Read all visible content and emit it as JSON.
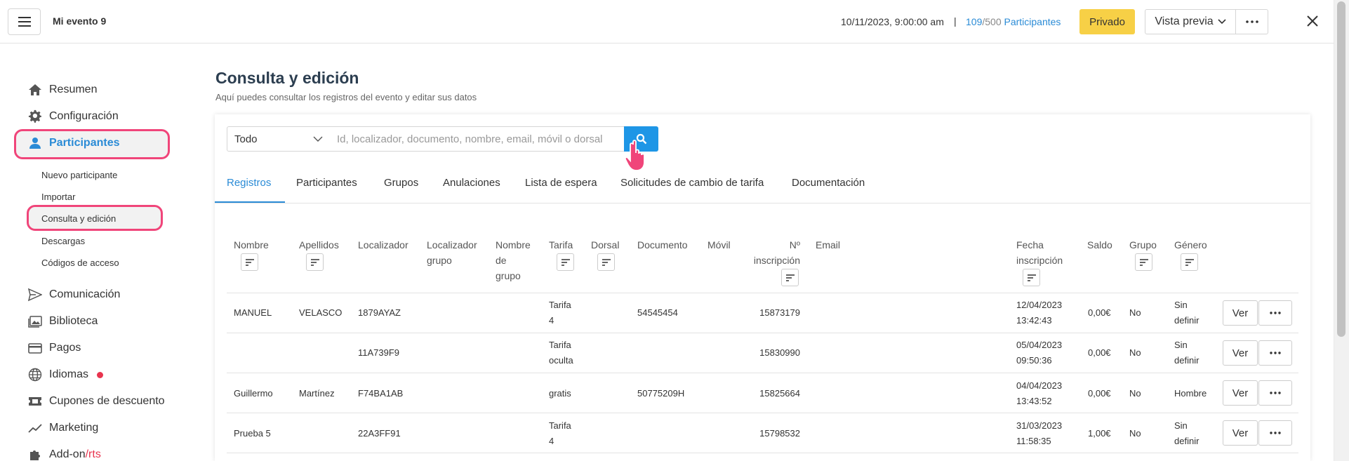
{
  "header": {
    "event_name": "Mi evento 9",
    "date": "10/11/2023, 9:00:00 am",
    "separator": "|",
    "count_current": "109",
    "count_total": "/500",
    "count_label": " Participantes",
    "privado_label": "Privado",
    "vista_label": "Vista previa"
  },
  "sidebar": {
    "items": [
      {
        "label": "Resumen",
        "icon": "home-icon"
      },
      {
        "label": "Configuración",
        "icon": "gear-icon"
      },
      {
        "label": "Participantes",
        "icon": "person-icon"
      },
      {
        "label": "Comunicación",
        "icon": "send-icon"
      },
      {
        "label": "Biblioteca",
        "icon": "images-icon"
      },
      {
        "label": "Pagos",
        "icon": "card-icon"
      },
      {
        "label": "Idiomas",
        "icon": "globe-icon"
      },
      {
        "label": "Cupones de descuento",
        "icon": "ticket-icon"
      },
      {
        "label": "Marketing",
        "icon": "trend-icon"
      },
      {
        "label": "Add-on",
        "icon": "puzzle-icon"
      }
    ],
    "addon_suffix": "/rts",
    "subitems": [
      "Nuevo participante",
      "Importar",
      "Consulta y edición",
      "Descargas",
      "Códigos de acceso"
    ]
  },
  "main": {
    "title": "Consulta y edición",
    "subtitle": "Aquí puedes consultar los registros del evento y editar sus datos",
    "filter_value": "Todo",
    "search_placeholder": "Id, localizador, documento, nombre, email, móvil o dorsal",
    "tabs": [
      "Registros",
      "Participantes",
      "Grupos",
      "Anulaciones",
      "Lista de espera",
      "Solicitudes de cambio de tarifa",
      "Documentación"
    ]
  },
  "table": {
    "headers": {
      "nombre": "Nombre",
      "apellidos": "Apellidos",
      "localizador": "Localizador",
      "localizador_grupo_1": "Localizador",
      "localizador_grupo_2": "grupo",
      "nombre_grupo_1": "Nombre",
      "nombre_grupo_2": "de",
      "nombre_grupo_3": "grupo",
      "tarifa": "Tarifa",
      "dorsal": "Dorsal",
      "documento": "Documento",
      "movil": "Móvil",
      "num_insc_1": "Nº",
      "num_insc_2": "inscripción",
      "email": "Email",
      "fecha_1": "Fecha",
      "fecha_2": "inscripción",
      "saldo": "Saldo",
      "grupo": "Grupo",
      "genero": "Género"
    },
    "ver_label": "Ver",
    "rows": [
      {
        "nombre": "MANUEL",
        "apellidos": "VELASCO",
        "localizador": "1879AYAZ",
        "tarifa_1": "Tarifa",
        "tarifa_2": "4",
        "documento": "54545454",
        "num": "15873179",
        "fecha_1": "12/04/2023",
        "fecha_2": "13:42:43",
        "saldo": "0,00€",
        "grupo": "No",
        "genero_1": "Sin",
        "genero_2": "definir"
      },
      {
        "nombre": "",
        "apellidos": "",
        "localizador": "11A739F9",
        "tarifa_1": "Tarifa",
        "tarifa_2": "oculta",
        "documento": "",
        "num": "15830990",
        "fecha_1": "05/04/2023",
        "fecha_2": "09:50:36",
        "saldo": "0,00€",
        "grupo": "No",
        "genero_1": "Sin",
        "genero_2": "definir"
      },
      {
        "nombre": "Guillermo",
        "apellidos": "Martínez",
        "localizador": "F74BA1AB",
        "tarifa_1": "gratis",
        "tarifa_2": "",
        "documento": "50775209H",
        "num": "15825664",
        "fecha_1": "04/04/2023",
        "fecha_2": "13:43:52",
        "saldo": "0,00€",
        "grupo": "No",
        "genero_1": "Hombre",
        "genero_2": ""
      },
      {
        "nombre": "Prueba 5",
        "apellidos": "",
        "localizador": "22A3FF91",
        "tarifa_1": "Tarifa",
        "tarifa_2": "4",
        "documento": "",
        "num": "15798532",
        "fecha_1": "31/03/2023",
        "fecha_2": "11:58:35",
        "saldo": "1,00€",
        "grupo": "No",
        "genero_1": "Sin",
        "genero_2": "definir"
      }
    ]
  },
  "colors": {
    "accent": "#2a8bd6",
    "highlight": "#f0457a",
    "privado": "#f7d046",
    "search_button": "#1e96e6"
  }
}
